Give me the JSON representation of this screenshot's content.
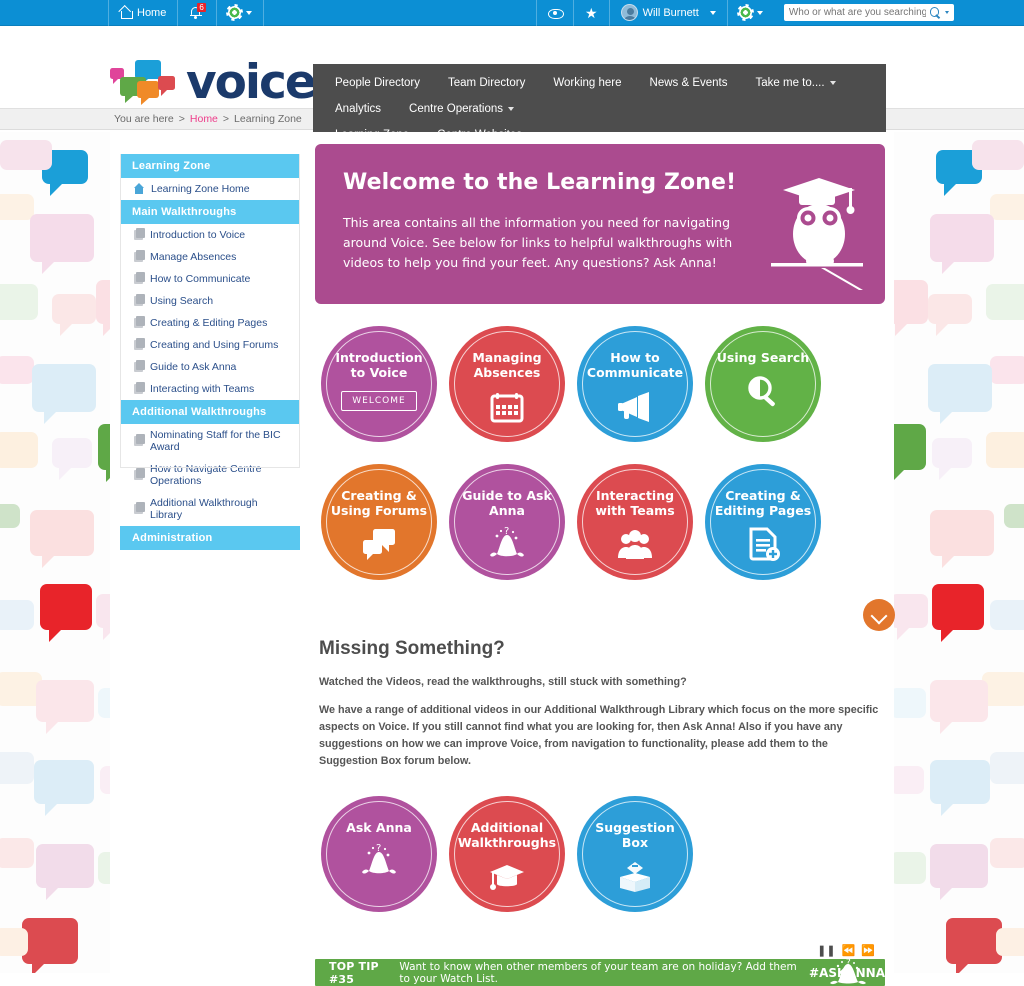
{
  "topbar": {
    "home_label": "Home",
    "notification_count": "6",
    "user_name": "Will Burnett",
    "search_placeholder": "Who or what are you searching for?...",
    "search_value": "",
    "bg_color": "#0c8fd4"
  },
  "brand": {
    "wordmark": "voice"
  },
  "nav": {
    "bg_color": "#4d4d4d",
    "items": [
      {
        "label": "People Directory",
        "has_caret": false
      },
      {
        "label": "Team Directory",
        "has_caret": false
      },
      {
        "label": "Working here",
        "has_caret": false
      },
      {
        "label": "News & Events",
        "has_caret": false
      },
      {
        "label": "Take me to....",
        "has_caret": true
      },
      {
        "label": "Analytics",
        "has_caret": false
      },
      {
        "label": "Centre Operations",
        "has_caret": true
      },
      {
        "label": "Learning Zone",
        "has_caret": false
      },
      {
        "label": "Centre Websites",
        "has_caret": true
      }
    ]
  },
  "breadcrumb": {
    "prefix": "You are here",
    "sep1": ">",
    "home": "Home",
    "sep2": ">",
    "current": "Learning Zone"
  },
  "sidebar": {
    "header_color": "#5ac8f0",
    "sections": [
      {
        "title": "Learning Zone",
        "items": [
          {
            "label": "Learning Zone Home",
            "icon": "home-icon"
          }
        ]
      },
      {
        "title": "Main Walkthroughs",
        "items": [
          {
            "label": "Introduction to Voice",
            "icon": "page-icon"
          },
          {
            "label": "Manage Absences",
            "icon": "page-icon"
          },
          {
            "label": "How to Communicate",
            "icon": "page-icon"
          },
          {
            "label": "Using Search",
            "icon": "page-icon"
          },
          {
            "label": "Creating & Editing Pages",
            "icon": "page-icon"
          },
          {
            "label": "Creating and Using Forums",
            "icon": "page-icon"
          },
          {
            "label": "Guide to Ask Anna",
            "icon": "page-icon"
          },
          {
            "label": "Interacting with Teams",
            "icon": "page-icon"
          }
        ]
      },
      {
        "title": "Additional Walkthroughs",
        "items": [
          {
            "label": "Nominating Staff for the BIC Award",
            "icon": "page-icon"
          },
          {
            "label": "How to Navigate Centre Operations",
            "icon": "page-icon"
          },
          {
            "label": "Additional Walkthrough Library",
            "icon": "page-icon"
          }
        ]
      },
      {
        "title": "Administration",
        "items": []
      }
    ]
  },
  "welcome": {
    "heading": "Welcome to the Learning Zone!",
    "body": "This area contains all the information you need for navigating around Voice. See below for links to helpful walkthroughs with videos to help you find your feet. Any questions? Ask Anna!",
    "bg_color": "#ab4b8f",
    "icon": "owl-graduate-icon"
  },
  "tiles": {
    "row1": [
      {
        "title": "Introduction to Voice",
        "color": "#b0529e",
        "icon": "welcome-badge",
        "badge_label": "WELCOME"
      },
      {
        "title": "Managing Absences",
        "color": "#dc4b50",
        "icon": "calendar-icon"
      },
      {
        "title": "How to Communicate",
        "color": "#2d9ed8",
        "icon": "megaphone-icon"
      },
      {
        "title": "Using Search",
        "color": "#62b247",
        "icon": "magnifier-icon"
      }
    ],
    "row2": [
      {
        "title": "Creating & Using Forums",
        "color": "#e2762c",
        "icon": "speech-bubbles-icon"
      },
      {
        "title": "Guide to Ask Anna",
        "color": "#b0529e",
        "icon": "anna-icon"
      },
      {
        "title": "Interacting with Teams",
        "color": "#dc4b50",
        "icon": "people-icon"
      },
      {
        "title": "Creating & Editing Pages",
        "color": "#2d9ed8",
        "icon": "document-plus-icon"
      }
    ],
    "row3": [
      {
        "title": "Ask Anna",
        "color": "#b0529e",
        "icon": "anna-icon"
      },
      {
        "title": "Additional Walkthroughs",
        "color": "#dc4b50",
        "icon": "graduation-cap-icon"
      },
      {
        "title": "Suggestion Box",
        "color": "#2d9ed8",
        "icon": "suggestion-box-icon"
      }
    ]
  },
  "scroll_button": {
    "icon": "chevron-down-icon",
    "color": "#e2762c"
  },
  "missing": {
    "heading": "Missing Something?",
    "lead": "Watched the Videos, read the walkthroughs, still stuck with something?",
    "body": "We have a range of additional videos in our Additional Walkthrough Library which focus on the more specific aspects on Voice. If you still cannot find what you are looking for, then Ask Anna! Also if you have any suggestions on how we can improve Voice, from navigation to functionality, please add them to the Suggestion Box forum below."
  },
  "ticker": {
    "bg_color": "#5fa847",
    "label": "TOP TIP #35",
    "text": "Want to know when other members of your team are on holiday? Add them to your Watch List.",
    "tag": "#ASKANNA",
    "controls": [
      {
        "name": "pause",
        "glyph": "❚❚"
      },
      {
        "name": "previous",
        "glyph": "⏪"
      },
      {
        "name": "next",
        "glyph": "⏩"
      }
    ]
  }
}
